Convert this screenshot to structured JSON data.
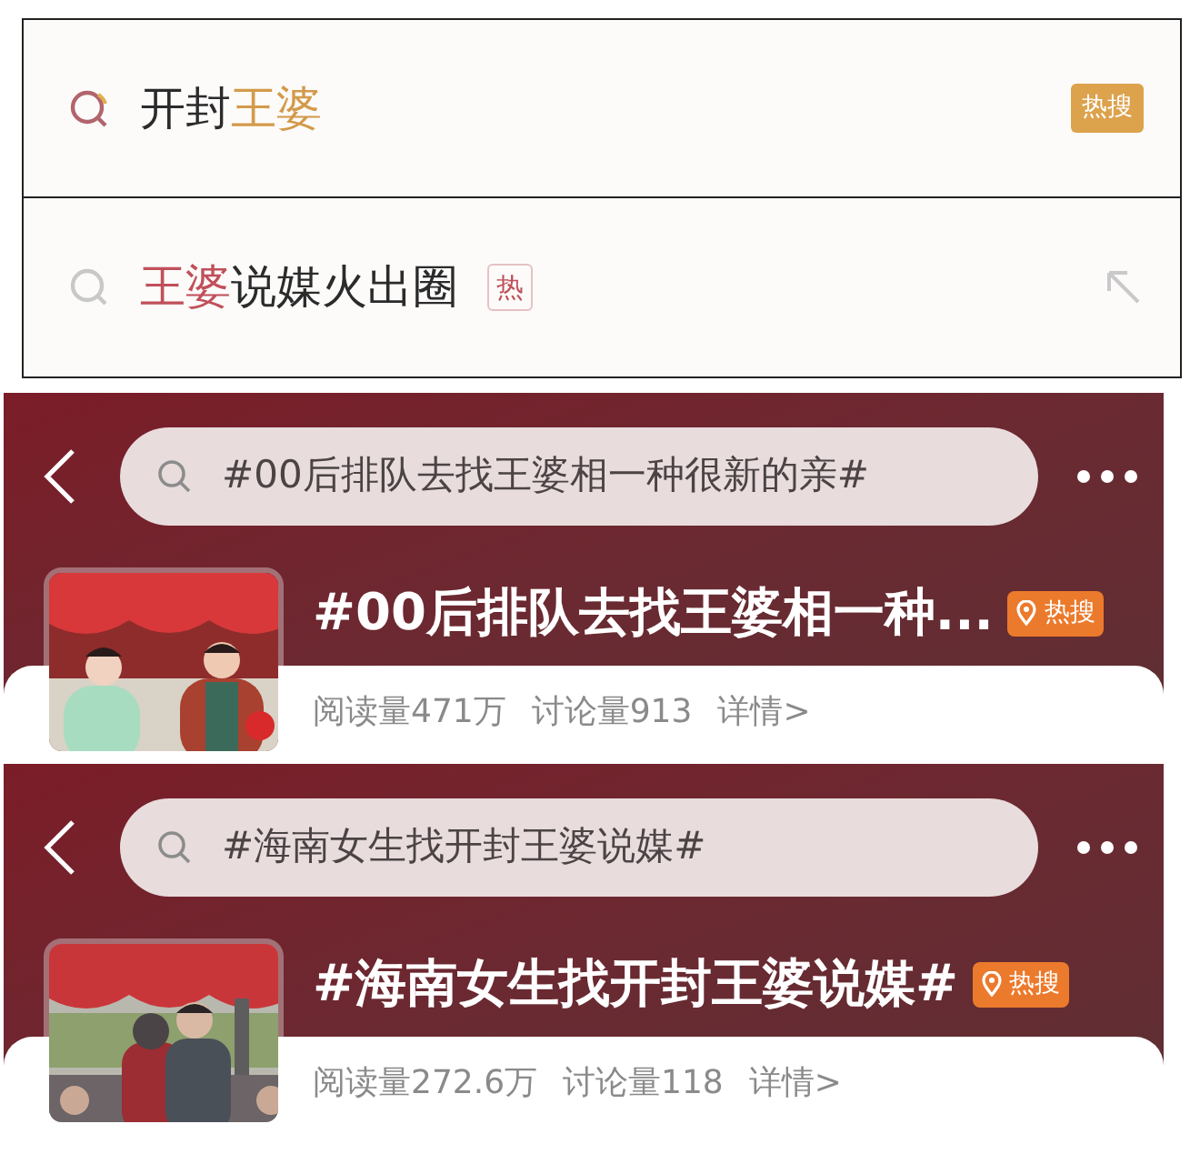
{
  "suggestions": [
    {
      "kind": "featured",
      "segments": [
        {
          "text": "开封",
          "highlight": false
        },
        {
          "text": "王婆",
          "highlight": true
        }
      ],
      "badge": "热搜"
    },
    {
      "kind": "plain",
      "segments": [
        {
          "text": "王婆",
          "highlight": true
        },
        {
          "text": "说媒火出圈",
          "highlight": false
        }
      ],
      "badge": "热"
    }
  ],
  "topics": [
    {
      "search_query": "#00后排队去找王婆相一种很新的亲#",
      "title": "#00后排队去找王婆相一种...",
      "badge": "热搜",
      "reads": "阅读量471万",
      "discussions": "讨论量913",
      "details": "详情>"
    },
    {
      "search_query": "#海南女生找开封王婆说媒#",
      "title": "#海南女生找开封王婆说媒#",
      "badge": "热搜",
      "reads": "阅读量272.6万",
      "discussions": "讨论量118",
      "details": "详情>"
    }
  ]
}
